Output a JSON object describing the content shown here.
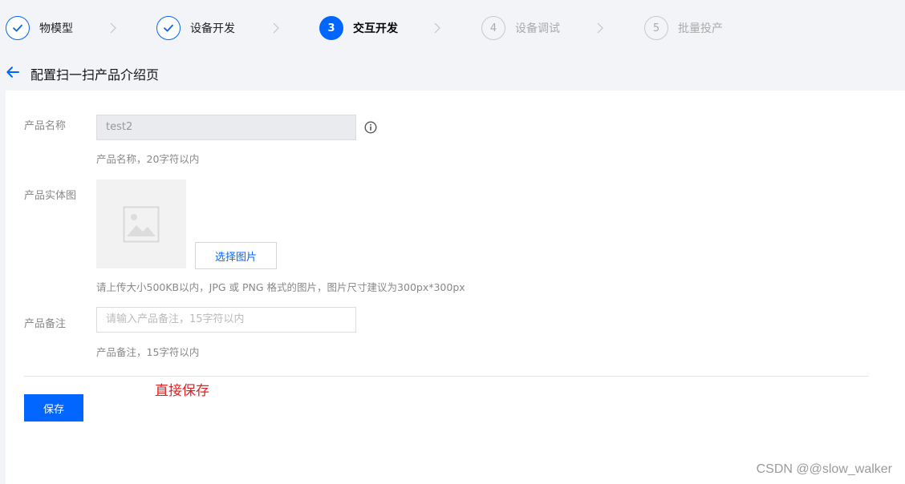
{
  "stepper": {
    "steps": [
      {
        "number": "",
        "label": "物模型",
        "state": "done"
      },
      {
        "number": "",
        "label": "设备开发",
        "state": "done"
      },
      {
        "number": "3",
        "label": "交互开发",
        "state": "active"
      },
      {
        "number": "4",
        "label": "设备调试",
        "state": "pending"
      },
      {
        "number": "5",
        "label": "批量投产",
        "state": "pending"
      }
    ],
    "accent_color": "#0066ff"
  },
  "header": {
    "title": "配置扫一扫产品介绍页",
    "back_icon": "arrow-left-icon"
  },
  "form": {
    "product_name": {
      "label": "产品名称",
      "value": "test2",
      "hint": "产品名称，20字符以内",
      "info_icon": "info-circle-icon"
    },
    "product_image": {
      "label": "产品实体图",
      "select_button": "选择图片",
      "hint": "请上传大小500KB以内，JPG 或 PNG 格式的图片，图片尺寸建议为300px*300px",
      "placeholder_icon": "image-placeholder-icon"
    },
    "product_note": {
      "label": "产品备注",
      "placeholder": "请输入产品备注，15字符以内",
      "hint": "产品备注，15字符以内"
    },
    "save_button": "保存",
    "annotation": "直接保存",
    "annotation_color": "#e02020"
  },
  "watermark": "CSDN @@slow_walker"
}
